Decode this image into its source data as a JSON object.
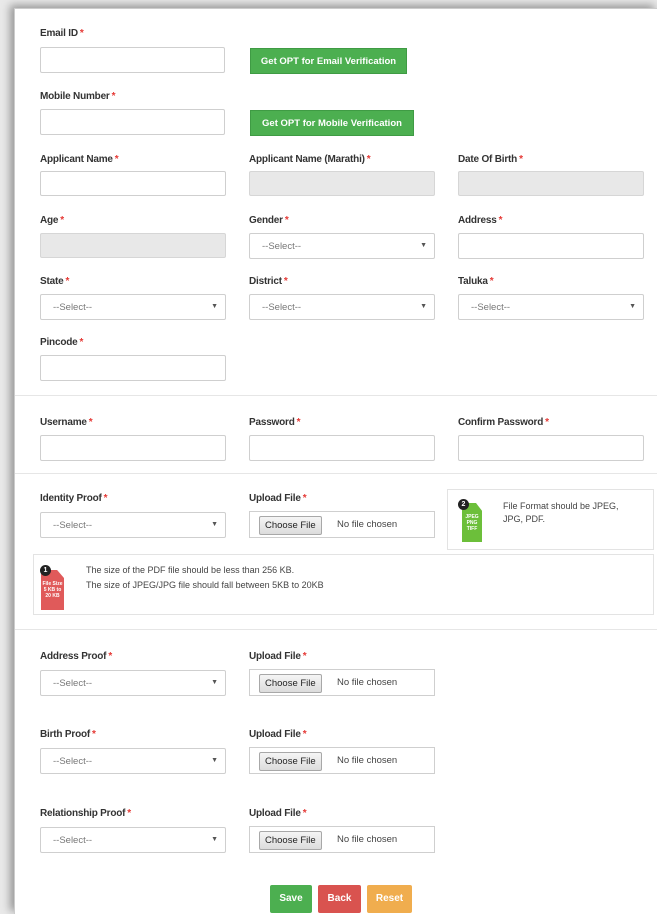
{
  "required_marker": "*",
  "email": {
    "label": "Email ID",
    "button": "Get OPT for Email Verification"
  },
  "mobile": {
    "label": "Mobile Number",
    "button": "Get OPT for Mobile Verification"
  },
  "applicant_name": {
    "label": "Applicant Name"
  },
  "applicant_name_marathi": {
    "label": "Applicant Name (Marathi)"
  },
  "dob": {
    "label": "Date Of Birth"
  },
  "age": {
    "label": "Age"
  },
  "gender": {
    "label": "Gender",
    "selected": "--Select--"
  },
  "address": {
    "label": "Address"
  },
  "state": {
    "label": "State",
    "selected": "--Select--"
  },
  "district": {
    "label": "District",
    "selected": "--Select--"
  },
  "taluka": {
    "label": "Taluka",
    "selected": "--Select--"
  },
  "pincode": {
    "label": "Pincode"
  },
  "username": {
    "label": "Username"
  },
  "password": {
    "label": "Password"
  },
  "confirm_password": {
    "label": "Confirm Password"
  },
  "identity_proof": {
    "label": "Identity Proof",
    "selected": "--Select--",
    "upload_label": "Upload File",
    "choose": "Choose File",
    "no_file": "No file chosen"
  },
  "format_info": {
    "badge": "2",
    "icon_lines": [
      "JPEG",
      "PNG",
      "TIFF"
    ],
    "text_line1": "File Format should be JPEG,",
    "text_line2": "JPG, PDF."
  },
  "size_info": {
    "badge": "1",
    "icon_lines": [
      "File Size",
      "5 KB to",
      "20 KB"
    ],
    "line1": "The size of the PDF file should be less than 256 KB.",
    "line2": "The size of JPEG/JPG file should fall between 5KB to 20KB"
  },
  "address_proof": {
    "label": "Address Proof",
    "selected": "--Select--",
    "upload_label": "Upload File",
    "choose": "Choose File",
    "no_file": "No file chosen"
  },
  "birth_proof": {
    "label": "Birth Proof",
    "selected": "--Select--",
    "upload_label": "Upload File",
    "choose": "Choose File",
    "no_file": "No file chosen"
  },
  "relationship_proof": {
    "label": "Relationship Proof",
    "selected": "--Select--",
    "upload_label": "Upload File",
    "choose": "Choose File",
    "no_file": "No file chosen"
  },
  "actions": {
    "save": "Save",
    "back": "Back",
    "reset": "Reset"
  },
  "icons": {
    "select_arrow": "▼"
  },
  "colors": {
    "green": "#4caf50",
    "red_required": "#e53935",
    "back": "#d9534f",
    "reset": "#f0ad4e"
  }
}
